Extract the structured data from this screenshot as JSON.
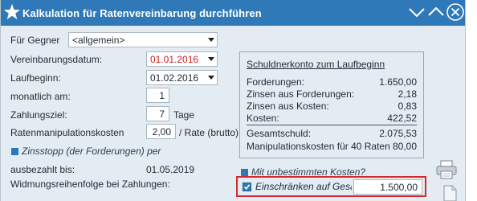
{
  "window": {
    "title": "Kalkulation für Ratenvereinbarung durchführen"
  },
  "form": {
    "opponent_label": "Für Gegner",
    "opponent_value": "<allgemein>",
    "agreement_date_label": "Vereinbarungsdatum:",
    "agreement_date_value": "01.01.2016",
    "start_label": "Laufbeginn:",
    "start_value": "01.02.2016",
    "monthly_label": "monatlich am:",
    "monthly_value": "1",
    "payment_target_label": "Zahlungsziel:",
    "payment_target_value": "7",
    "payment_target_unit": "Tage",
    "manipulation_label": "Ratenmanipulationskosten",
    "manipulation_value": "2,00",
    "manipulation_unit": "/ Rate (brutto)",
    "interest_stop_label": "Zinsstopp (der Forderungen) per",
    "paid_out_label": "ausbezahlt bis:",
    "paid_out_value": "01.05.2019",
    "dedication_label": "Widmungsreihenfolge bei Zahlungen:"
  },
  "summary": {
    "heading": "Schuldnerkonto zum Laufbeginn",
    "rows": [
      {
        "label": "Forderungen:",
        "value": "1.650,00"
      },
      {
        "label": "Zinsen aus Forderungen:",
        "value": "2,18"
      },
      {
        "label": "Zinsen aus Kosten:",
        "value": "0,83"
      },
      {
        "label": "Kosten:",
        "value": "422,52"
      },
      {
        "label": "Gesamtschuld:",
        "value": "2.075,53"
      },
      {
        "label": "Manipulationskosten für 40 Raten",
        "value": "80,00"
      }
    ]
  },
  "options": {
    "unlimited_costs_label": "Mit unbestimmten Kosten?",
    "restrict_label": "Einschränken auf Gesamtbetrag",
    "restrict_checked": true,
    "restrict_amount": "1.500,00"
  },
  "colors": {
    "titlebar": "#2f79b8",
    "accent": "#2f79b8",
    "date_red": "#d11f1f",
    "highlight_border": "#d62a2a"
  }
}
